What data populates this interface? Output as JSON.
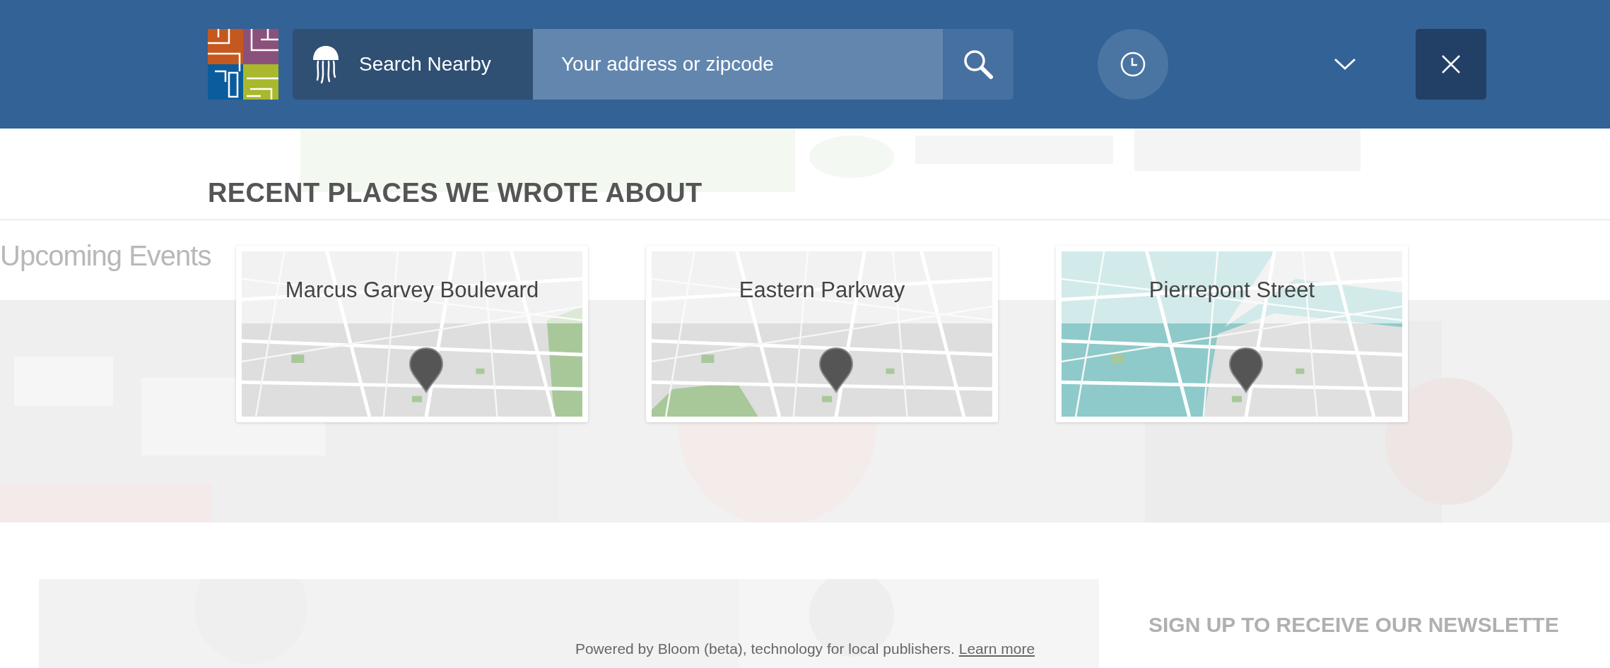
{
  "header": {
    "search_label": "Search Nearby",
    "search": {
      "placeholder": "Your address or zipcode"
    }
  },
  "background": {
    "events_heading": "Upcoming Events",
    "newsletter_heading": "SIGN UP TO RECEIVE OUR NEWSLETTE"
  },
  "section": {
    "title": "RECENT PLACES WE WROTE ABOUT"
  },
  "places": [
    {
      "name": "Marcus Garvey Boulevard"
    },
    {
      "name": "Eastern Parkway"
    },
    {
      "name": "Pierrepont Street"
    }
  ],
  "footer": {
    "text": "Powered by Bloom (beta), technology for local publishers.",
    "link": "Learn more"
  }
}
